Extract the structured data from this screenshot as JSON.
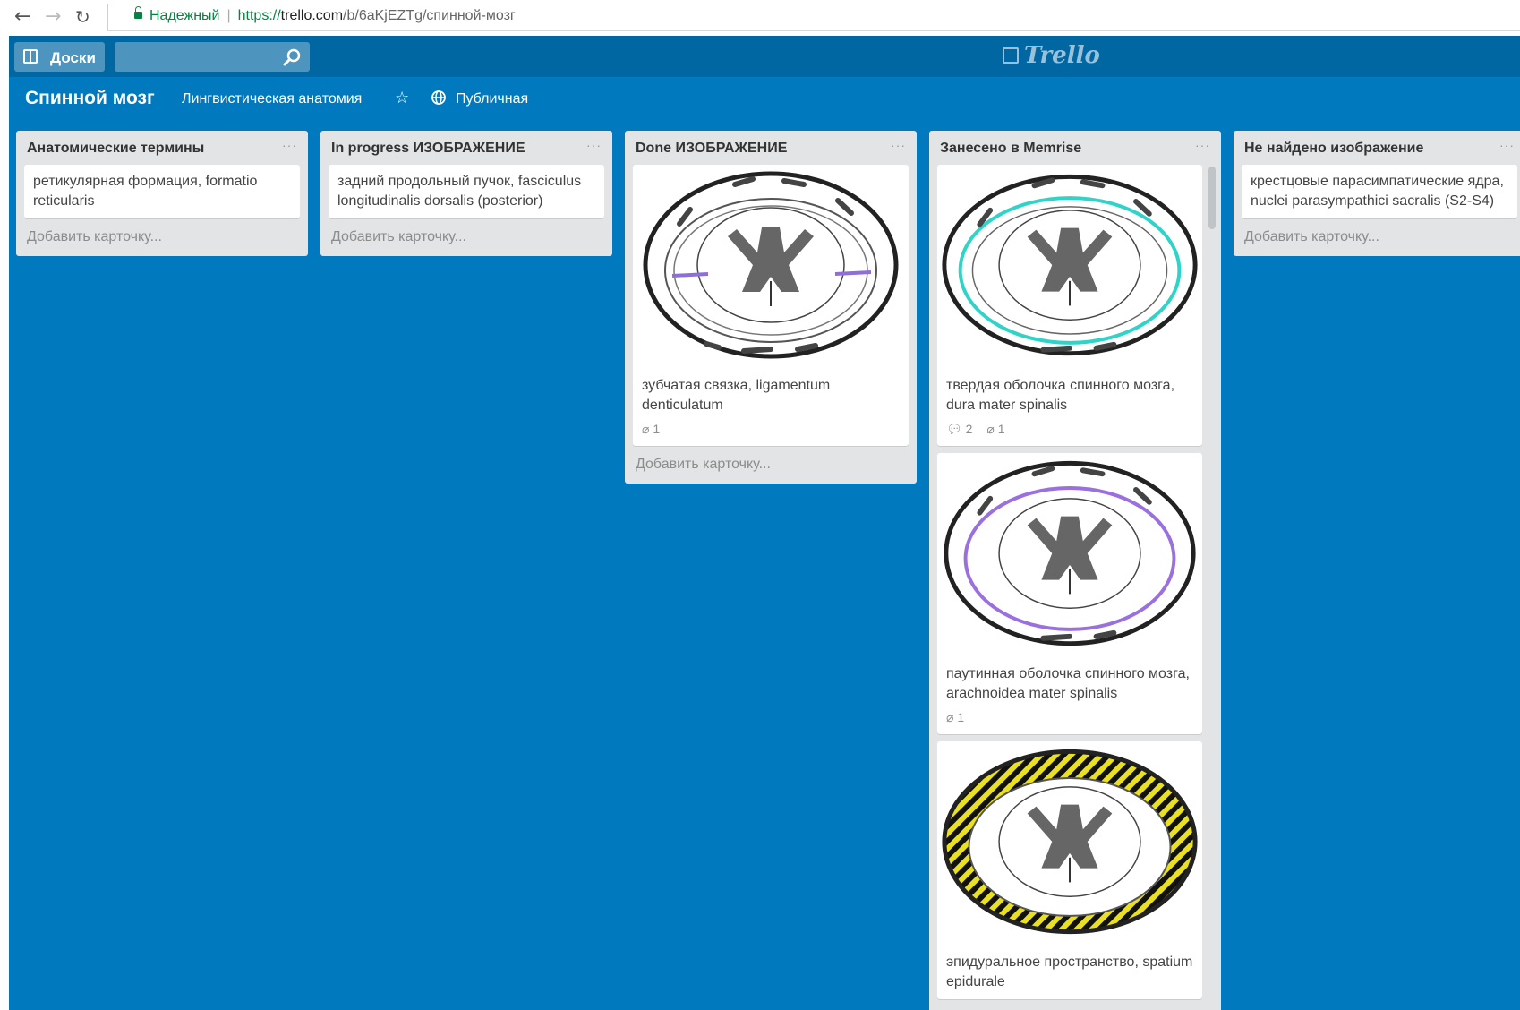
{
  "browser": {
    "secure_label": "Надежный",
    "url_scheme": "https://",
    "url_host": "trello.com",
    "url_path": "/b/6aKjEZTg/спинной-мозг"
  },
  "header": {
    "boards_label": "Доски",
    "logo_text": "Trello"
  },
  "board": {
    "title": "Спинной мозг",
    "team": "Лингвистическая анатомия",
    "visibility": "Публичная",
    "background": "#0079bf"
  },
  "lists": [
    {
      "title": "Анатомические термины",
      "cards": [
        {
          "text": "ретикулярная формация, formatio reticularis"
        }
      ],
      "add_label": "Добавить карточку..."
    },
    {
      "title": "In progress ИЗОБРАЖЕНИЕ",
      "cards": [
        {
          "text": "задний продольный пучок, fasciculus longitudinalis dorsalis (posterior)"
        }
      ],
      "add_label": "Добавить карточку..."
    },
    {
      "title": "Done ИЗОБРАЖЕНИЕ",
      "cards": [
        {
          "text": "зубчатая связка, ligamentum denticulatum",
          "attachments": "1"
        }
      ],
      "add_label": "Добавить карточку..."
    },
    {
      "title": "Занесено в Memrise",
      "cards": [
        {
          "text": "твердая оболочка спинного мозга, dura mater spinalis",
          "comments": "2",
          "attachments": "1"
        },
        {
          "text": "паутинная оболочка спинного мозга, arachnoidea mater spinalis",
          "attachments": "1"
        },
        {
          "text": "эпидуральное пространство, spatium epidurale"
        }
      ]
    },
    {
      "title": "Не найдено изображение",
      "cards": [
        {
          "text": "крестцовые парасимпатические ядра, nuclei parasympathici sacralis (S2-S4)"
        }
      ],
      "add_label": "Добавить карточку..."
    }
  ]
}
